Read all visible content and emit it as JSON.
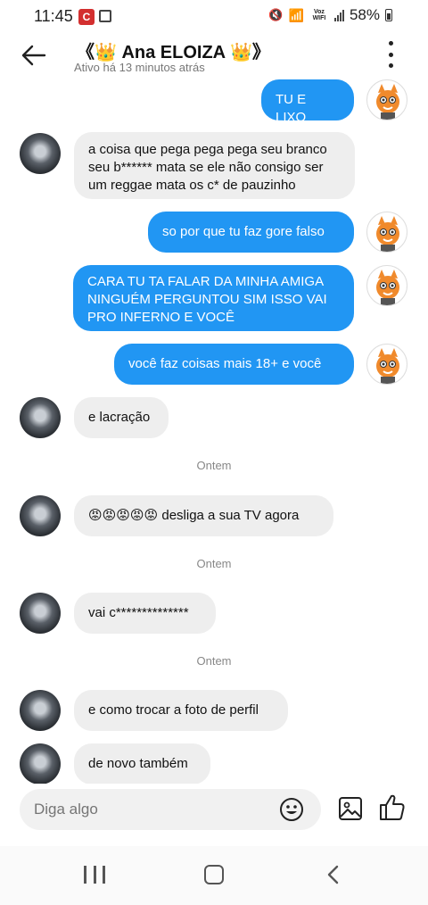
{
  "status_bar": {
    "time": "11:45",
    "app_icon_letter": "C",
    "voz_label": "Voz WIFI",
    "battery": "58%"
  },
  "header": {
    "title": "《👑 Ana ELOIZA 👑》",
    "subtitle": "Ativo há 13 minutos atrás"
  },
  "messages": [
    {
      "side": "out",
      "lines": [
        "TU E LIXO"
      ]
    },
    {
      "side": "in",
      "lines": [
        "a coisa que pega pega pega seu branco",
        "seu b****** mata se ele não consigo ser",
        "um reggae mata os c* de pauzinho"
      ]
    },
    {
      "side": "out",
      "lines": [
        "so por que tu faz gore falso"
      ]
    },
    {
      "side": "out",
      "lines": [
        "CARA TU TA FALAR DA MINHA AMIGA",
        "NINGUÉM PERGUNTOU SIM ISSO VAI",
        "PRO INFERNO E VOCÊ"
      ]
    },
    {
      "side": "out",
      "lines": [
        "você faz coisas mais 18+ e você"
      ]
    },
    {
      "side": "in",
      "lines": [
        "e lacração"
      ]
    },
    {
      "side": "in",
      "lines": [
        "😡😡😡😡😡 desliga a sua TV agora"
      ]
    },
    {
      "side": "in",
      "lines": [
        "vai c**************"
      ]
    },
    {
      "side": "in",
      "lines": [
        "e como trocar a foto de perfil"
      ]
    },
    {
      "side": "in",
      "lines": [
        "de novo também"
      ]
    }
  ],
  "date_separators": [
    "Ontem",
    "Ontem",
    "Ontem"
  ],
  "composer": {
    "placeholder": "Diga algo"
  },
  "icons": {
    "back": "arrow-left-icon",
    "menu": "more-vertical-icon",
    "emoji": "smiley-icon",
    "image": "image-icon",
    "like": "thumbs-up-icon"
  },
  "colors": {
    "outgoing_bubble": "#2196f3",
    "incoming_bubble": "#eeeeee"
  }
}
